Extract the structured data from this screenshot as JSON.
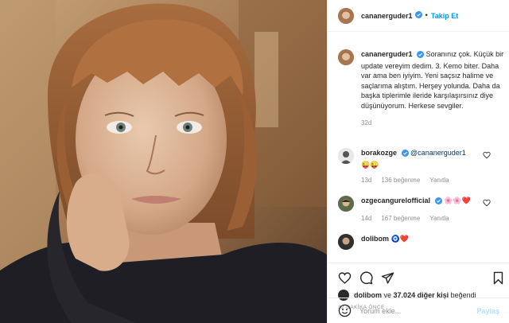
{
  "header": {
    "username": "cananerguder1",
    "follow_label": "Takip Et",
    "dot": "•"
  },
  "caption": {
    "username": "cananerguder1",
    "text": "Soranınız çok. Küçük bir update vereyim dedim. 3. Kemo biter. Daha var ama ben iyiyim. Yeni saçsız halime ve saçlarıma alıştım. Herşey yolunda. Daha da başka tiplerimle ileride karşılaşırsınız diye düşünüyorum. Herkese sevgiler.",
    "time": "32d"
  },
  "comments": [
    {
      "username": "borakozge",
      "mention": "@cananerguder1",
      "emojis": "😜😜",
      "time": "13d",
      "likes": "136 beğenme",
      "reply": "Yanıtla"
    },
    {
      "username": "ozgecangurelofficial",
      "emojis": "🌸🌸❤️",
      "time": "14d",
      "likes": "167 beğenme",
      "reply": "Yanıtla"
    },
    {
      "username": "dolibom",
      "emojis": "🧿❤️"
    }
  ],
  "likes": {
    "user": "dolibom",
    "connector": "ve",
    "others": "37.024 diğer kişi",
    "suffix": "beğendi"
  },
  "ago": "32 DAKİKA ÖNCE",
  "comment_box": {
    "placeholder": "Yorum ekle...",
    "share_label": "Paylaş"
  },
  "icons": {
    "verified": "verified-badge-icon",
    "heart": "heart-icon",
    "comment": "comment-icon",
    "share": "direct-share-icon",
    "save": "bookmark-icon",
    "emoji": "smiley-icon",
    "more": "more-options-icon"
  },
  "colors": {
    "link_blue": "#0095f6",
    "muted": "#8e8e8e",
    "text": "#262626",
    "share_disabled": "#b2dffc"
  }
}
